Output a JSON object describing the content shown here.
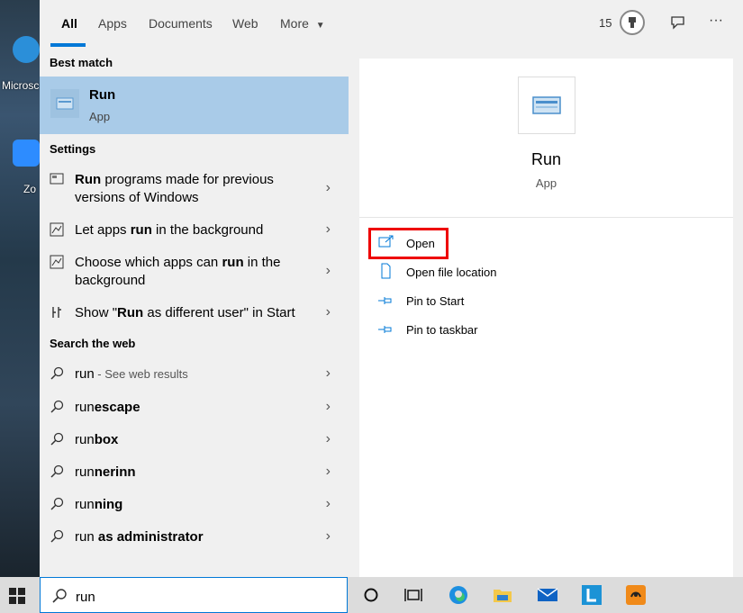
{
  "desktop": {
    "icons": [
      {
        "label": "Microsc",
        "color": "#2b8fd9"
      },
      {
        "label": "Zo",
        "color": "#2d8cff"
      }
    ]
  },
  "tabs": [
    {
      "label": "All",
      "active": true
    },
    {
      "label": "Apps"
    },
    {
      "label": "Documents"
    },
    {
      "label": "Web"
    },
    {
      "label": "More"
    }
  ],
  "header": {
    "points": "15",
    "icons": [
      "rewards-badge-icon",
      "feedback-icon",
      "more-options-icon"
    ]
  },
  "best_match": {
    "section_label": "Best match",
    "title": "Run",
    "subtitle": "App"
  },
  "settings": {
    "section_label": "Settings",
    "items": [
      {
        "bold": "Run",
        "rest": " programs made for previous versions of Windows",
        "icon": "compat-icon"
      },
      {
        "pre": "Let apps ",
        "bold": "run",
        "rest": " in the background",
        "icon": "background-apps-icon"
      },
      {
        "pre": "Choose which apps can ",
        "bold": "run",
        "rest": " in the background",
        "icon": "background-apps-icon"
      },
      {
        "pre": "Show \"",
        "bold": "Run",
        "rest": " as different user\" in Start",
        "icon": "start-settings-icon"
      }
    ]
  },
  "web": {
    "section_label": "Search the web",
    "items": [
      {
        "pre": "run",
        "rest": " - See web results"
      },
      {
        "pre": "run",
        "bold": "escape"
      },
      {
        "pre": "run",
        "bold": "box"
      },
      {
        "pre": "run",
        "bold": "nerinn"
      },
      {
        "pre": "run",
        "bold": "ning"
      },
      {
        "pre": "run",
        "bold": " as administrator"
      }
    ]
  },
  "preview": {
    "title": "Run",
    "subtitle": "App",
    "actions": [
      {
        "label": "Open",
        "icon": "open-icon"
      },
      {
        "label": "Open file location",
        "icon": "file-location-icon"
      },
      {
        "label": "Pin to Start",
        "icon": "pin-icon"
      },
      {
        "label": "Pin to taskbar",
        "icon": "pin-icon"
      }
    ]
  },
  "search": {
    "value": "run"
  },
  "taskbar": {
    "apps": [
      "cortana-icon",
      "task-view-icon",
      "edge-icon",
      "file-explorer-icon",
      "mail-icon",
      "l-app-icon",
      "orange-app-icon"
    ]
  },
  "colors": {
    "accent": "#0078d7",
    "highlight": "#a9cbe8",
    "annotation": "#ee0000"
  }
}
